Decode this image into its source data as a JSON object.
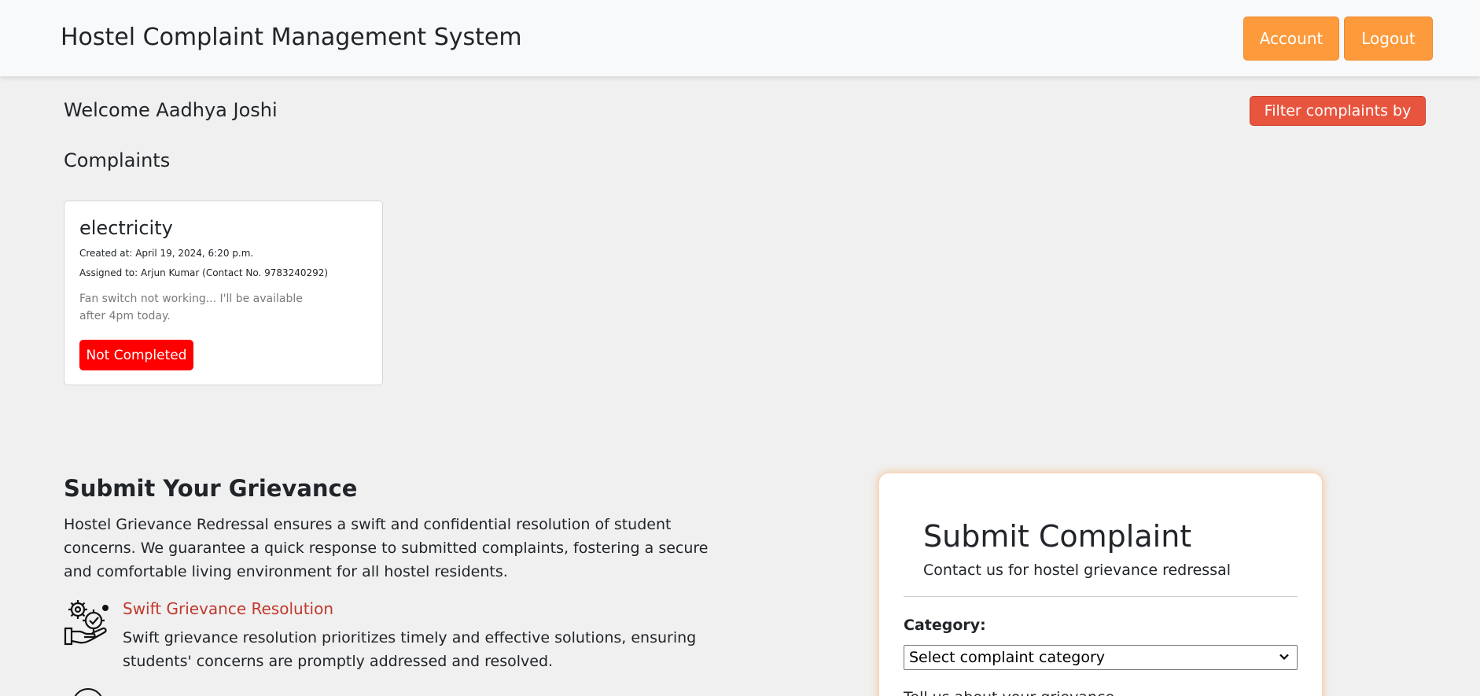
{
  "header": {
    "title": "Hostel Complaint Management System",
    "account_label": "Account",
    "logout_label": "Logout"
  },
  "welcome_text": "Welcome Aadhya Joshi",
  "filter_label": "Filter complaints by",
  "complaints_heading": "Complaints",
  "complaints": [
    {
      "category": "electricity",
      "created_at": "Created at: April 19, 2024, 6:20 p.m.",
      "assigned_to": "Assigned to: Arjun Kumar (Contact No. 9783240292)",
      "description": "Fan switch not working... I'll be available after 4pm today.",
      "status": "Not Completed"
    }
  ],
  "grievance": {
    "title": "Submit Your Grievance",
    "text": "Hostel Grievance Redressal ensures a swift and confidential resolution of student concerns. We guarantee a quick response to submitted complaints, fostering a secure and comfortable living environment for all hostel residents.",
    "features": [
      {
        "title": "Swift Grievance Resolution",
        "text": "Swift grievance resolution prioritizes timely and effective solutions, ensuring students' concerns are promptly addressed and resolved.",
        "icon": "gear-hand-check-icon"
      }
    ]
  },
  "form": {
    "title": "Submit Complaint",
    "subtitle": "Contact us for hostel grievance redressal",
    "category_label": "Category:",
    "category_selected": "Select complaint category",
    "grievance_label": "Tell us about your grievance"
  },
  "colors": {
    "accent_orange": "#fd9a3c",
    "filter_red": "#e8553e",
    "status_red": "#ff0000",
    "feature_title": "#c0392b"
  }
}
